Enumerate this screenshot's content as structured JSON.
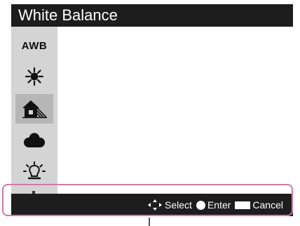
{
  "title": "White Balance",
  "sidebar": {
    "items": [
      {
        "label": "AWB",
        "icon": "awb-icon",
        "selected": false
      },
      {
        "label": "",
        "icon": "daylight-sun-icon",
        "selected": false
      },
      {
        "label": "",
        "icon": "shade-house-icon",
        "selected": true
      },
      {
        "label": "",
        "icon": "cloudy-icon",
        "selected": false
      },
      {
        "label": "",
        "icon": "incandescent-bulb-icon",
        "selected": false
      }
    ]
  },
  "footer": {
    "select_label": "Select",
    "enter_label": "Enter",
    "cancel_label": "Cancel",
    "select_icon": "four-way-arrows-icon",
    "enter_icon": "center-button-icon",
    "cancel_icon": "menu-button-icon"
  },
  "colors": {
    "bar_bg": "#1d1d1d",
    "sidebar_bg": "#d4d4d4",
    "selected_bg": "#b6b6b6",
    "highlight_border": "#d07aa8"
  }
}
